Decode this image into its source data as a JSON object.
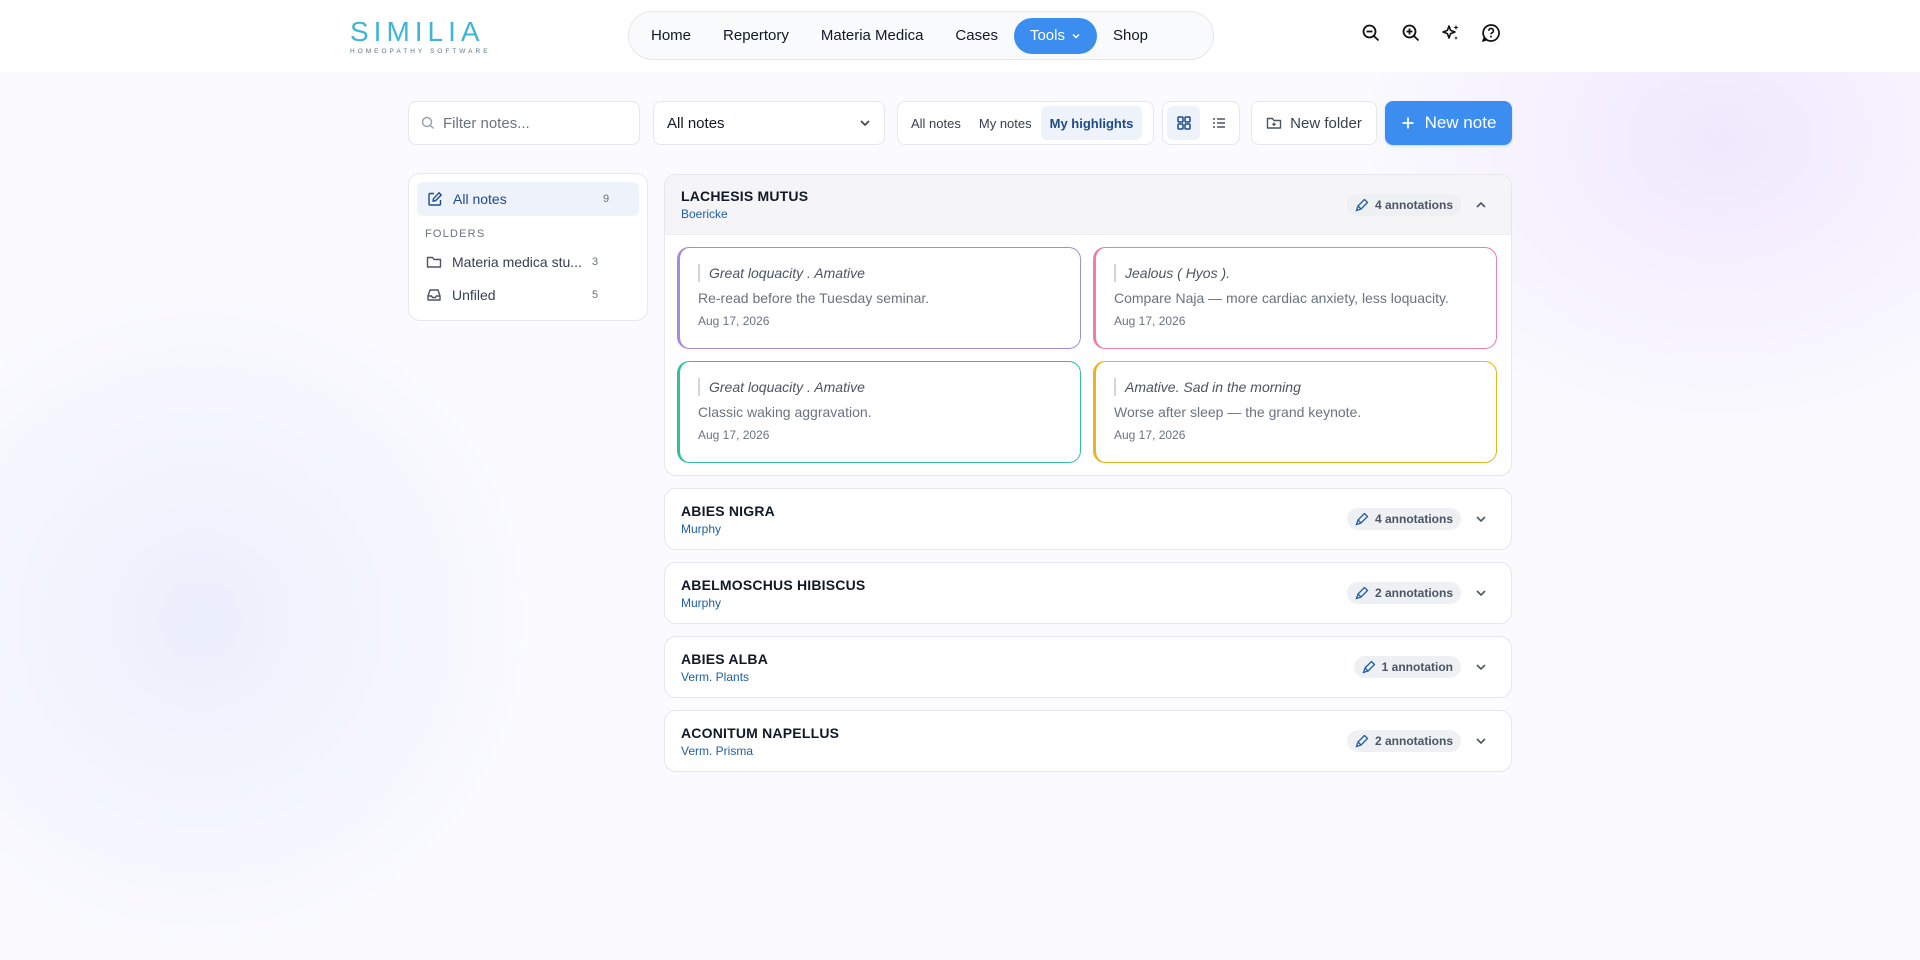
{
  "brand": {
    "name": "SIMILIA",
    "tagline": "HOMEOPATHY SOFTWARE"
  },
  "nav": {
    "items": [
      {
        "label": "Home",
        "active": false
      },
      {
        "label": "Repertory",
        "active": false
      },
      {
        "label": "Materia Medica",
        "active": false
      },
      {
        "label": "Cases",
        "active": false
      },
      {
        "label": "Tools",
        "active": true,
        "dropdown": true
      },
      {
        "label": "Shop",
        "active": false
      }
    ]
  },
  "header_icons": [
    "zoom-out-icon",
    "zoom-in-icon",
    "sparkles-icon",
    "help-icon"
  ],
  "toolbar": {
    "filter_placeholder": "Filter notes...",
    "filter_value": "",
    "select_value": "All notes",
    "segments": [
      {
        "label": "All notes",
        "active": false
      },
      {
        "label": "My notes",
        "active": false
      },
      {
        "label": "My highlights",
        "active": true
      }
    ],
    "view_mode": "grid",
    "new_folder_label": "New folder",
    "new_note_label": "New note"
  },
  "sidebar": {
    "all_notes": {
      "label": "All notes",
      "count": "9"
    },
    "folders_heading": "FOLDERS",
    "folders": [
      {
        "label": "Materia medica stu...",
        "count": "3",
        "icon": "folder-icon"
      },
      {
        "label": "Unfiled",
        "count": "5",
        "icon": "inbox-icon"
      }
    ]
  },
  "groups": [
    {
      "title": "LACHESIS MUTUS",
      "source": "Boericke",
      "badge": "4 annotations",
      "open": true,
      "cards": [
        {
          "quote": "Great loquacity . Amative",
          "note": "Re-read before the Tuesday seminar.",
          "date": "Aug 17, 2026",
          "color": "#a78bdb"
        },
        {
          "quote": "Jealous ( Hyos ).",
          "note": "Compare Naja — more cardiac anxiety, less loquacity.",
          "date": "Aug 17, 2026",
          "color": "#ec7fa8"
        },
        {
          "quote": "Great loquacity . Amative",
          "note": "Classic waking aggravation.",
          "date": "Aug 17, 2026",
          "color": "#34c09a"
        },
        {
          "quote": "Amative. Sad in the morning",
          "note": "Worse after sleep — the grand keynote.",
          "date": "Aug 17, 2026",
          "color": "#e9b41f"
        }
      ]
    },
    {
      "title": "ABIES NIGRA",
      "source": "Murphy",
      "badge": "4 annotations",
      "open": false
    },
    {
      "title": "ABELMOSCHUS HIBISCUS",
      "source": "Murphy",
      "badge": "2 annotations",
      "open": false
    },
    {
      "title": "ABIES ALBA",
      "source": "Verm. Plants",
      "badge": "1 annotation",
      "open": false
    },
    {
      "title": "ACONITUM NAPELLUS",
      "source": "Verm. Prisma",
      "badge": "2 annotations",
      "open": false
    }
  ],
  "colors": {
    "accent": "#3b8ef0",
    "source_link": "#1d5fa6",
    "brand": "#3fb6d3"
  }
}
